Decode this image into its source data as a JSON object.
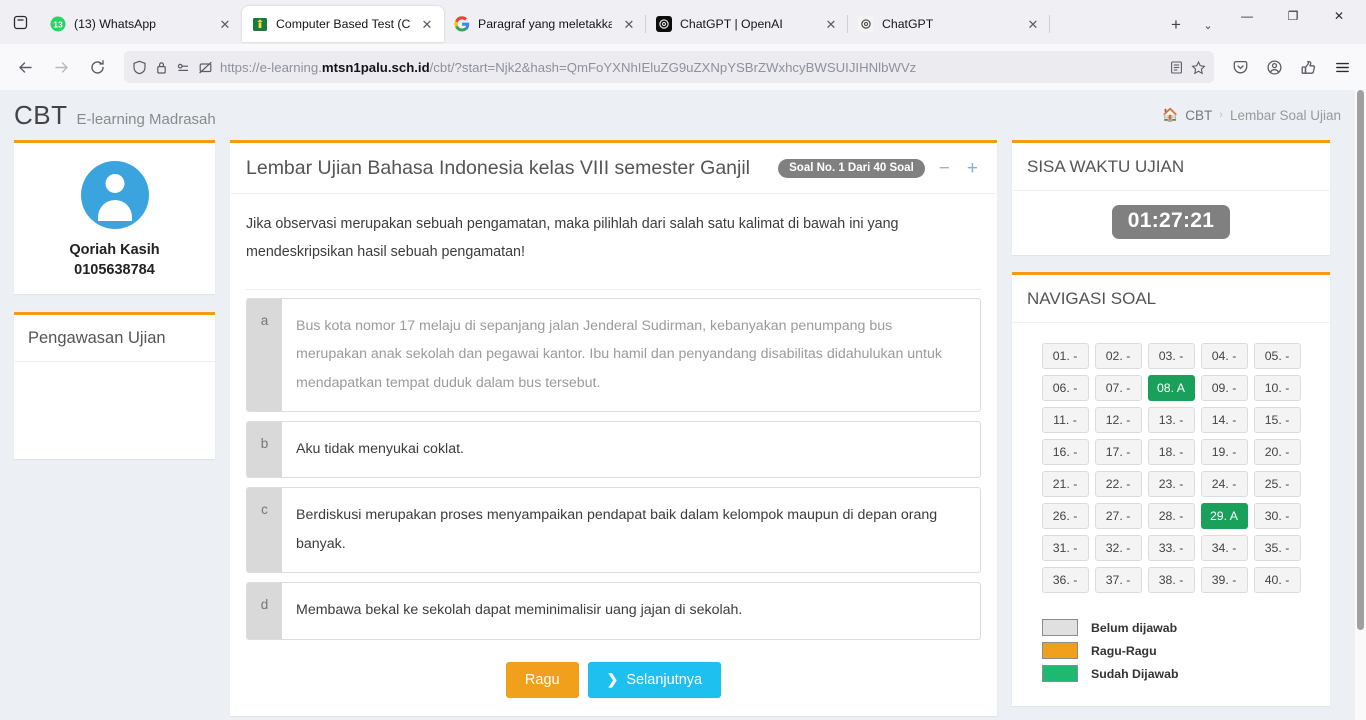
{
  "browser": {
    "tabs": [
      {
        "title": "(13) WhatsApp",
        "favicon": "whatsapp-icon",
        "active": false
      },
      {
        "title": "Computer Based Test (CBT)",
        "favicon": "madrasah-icon",
        "active": true
      },
      {
        "title": "Paragraf yang meletakkan ga",
        "favicon": "google-icon",
        "active": false
      },
      {
        "title": "ChatGPT | OpenAI",
        "favicon": "openai-dark-icon",
        "active": false
      },
      {
        "title": "ChatGPT",
        "favicon": "openai-light-icon",
        "active": false
      }
    ],
    "close_label": "✕",
    "newtab_label": "+",
    "tablist_chevron": "⌄",
    "window": {
      "minimize": "—",
      "maximize": "❐",
      "close": "✕"
    },
    "url": {
      "prefix": "https://e-learning.",
      "domain": "mtsn1palu.sch.id",
      "suffix": "/cbt/?start=Njk2&hash=QmFoYXNhIEluZG9uZXNpYSBrZWxhcyBWSUIJIHNlbWVz"
    }
  },
  "header": {
    "brand": "CBT",
    "brand_sub": "E-learning Madrasah",
    "breadcrumb": {
      "home_icon": "🏠",
      "root": "CBT",
      "separator": "›",
      "current": "Lembar Soal Ujian"
    }
  },
  "sidebar_left": {
    "user": {
      "name": "Qoriah Kasih",
      "id": "0105638784"
    },
    "watch_panel_title": "Pengawasan Ujian"
  },
  "exam": {
    "title": "Lembar Ujian Bahasa Indonesia kelas VIII semester Ganjil",
    "badge": "Soal No. 1 Dari 40 Soal",
    "zoom_out": "−",
    "zoom_in": "+",
    "question": "Jika observasi merupakan sebuah pengamatan, maka pilihlah dari salah satu kalimat di bawah ini yang mendeskripsikan hasil sebuah pengamatan!",
    "options": [
      {
        "letter": "a",
        "text": "Bus kota nomor 17 melaju di sepanjang jalan Jenderal Sudirman, kebanyakan penumpang bus merupakan anak sekolah dan pegawai kantor. Ibu hamil dan penyandang disabilitas didahulukan untuk mendapatkan tempat duduk dalam bus tersebut.",
        "muted": true
      },
      {
        "letter": "b",
        "text": "Aku tidak menyukai coklat.",
        "muted": false
      },
      {
        "letter": "c",
        "text": "Berdiskusi merupakan proses menyampaikan pendapat baik dalam kelompok maupun di depan orang banyak.",
        "muted": false
      },
      {
        "letter": "d",
        "text": "Membawa bekal ke sekolah dapat meminimalisir uang jajan di sekolah.",
        "muted": false
      }
    ],
    "buttons": {
      "doubt": "Ragu",
      "next": "Selanjutnya",
      "next_chevron": "❯"
    }
  },
  "sidebar_right": {
    "timer_title": "SISA WAKTU UJIAN",
    "timer_value": "01:27:21",
    "nav_title": "NAVIGASI SOAL",
    "nav_cells": [
      {
        "label": "01. -",
        "state": "unanswered"
      },
      {
        "label": "02. -",
        "state": "unanswered"
      },
      {
        "label": "03. -",
        "state": "unanswered"
      },
      {
        "label": "04. -",
        "state": "unanswered"
      },
      {
        "label": "05. -",
        "state": "unanswered"
      },
      {
        "label": "06. -",
        "state": "unanswered"
      },
      {
        "label": "07. -",
        "state": "unanswered"
      },
      {
        "label": "08. A",
        "state": "answered"
      },
      {
        "label": "09. -",
        "state": "unanswered"
      },
      {
        "label": "10. -",
        "state": "unanswered"
      },
      {
        "label": "11. -",
        "state": "unanswered"
      },
      {
        "label": "12. -",
        "state": "unanswered"
      },
      {
        "label": "13. -",
        "state": "unanswered"
      },
      {
        "label": "14. -",
        "state": "unanswered"
      },
      {
        "label": "15. -",
        "state": "unanswered"
      },
      {
        "label": "16. -",
        "state": "unanswered"
      },
      {
        "label": "17. -",
        "state": "unanswered"
      },
      {
        "label": "18. -",
        "state": "unanswered"
      },
      {
        "label": "19. -",
        "state": "unanswered"
      },
      {
        "label": "20. -",
        "state": "unanswered"
      },
      {
        "label": "21. -",
        "state": "unanswered"
      },
      {
        "label": "22. -",
        "state": "unanswered"
      },
      {
        "label": "23. -",
        "state": "unanswered"
      },
      {
        "label": "24. -",
        "state": "unanswered"
      },
      {
        "label": "25. -",
        "state": "unanswered"
      },
      {
        "label": "26. -",
        "state": "unanswered"
      },
      {
        "label": "27. -",
        "state": "unanswered"
      },
      {
        "label": "28. -",
        "state": "unanswered"
      },
      {
        "label": "29. A",
        "state": "answered"
      },
      {
        "label": "30. -",
        "state": "unanswered"
      },
      {
        "label": "31. -",
        "state": "unanswered"
      },
      {
        "label": "32. -",
        "state": "unanswered"
      },
      {
        "label": "33. -",
        "state": "unanswered"
      },
      {
        "label": "34. -",
        "state": "unanswered"
      },
      {
        "label": "35. -",
        "state": "unanswered"
      },
      {
        "label": "36. -",
        "state": "unanswered"
      },
      {
        "label": "37. -",
        "state": "unanswered"
      },
      {
        "label": "38. -",
        "state": "unanswered"
      },
      {
        "label": "39. -",
        "state": "unanswered"
      },
      {
        "label": "40. -",
        "state": "unanswered"
      }
    ],
    "legend": [
      {
        "label": "Belum dijawab",
        "color": "#e0e0e0"
      },
      {
        "label": "Ragu-Ragu",
        "color": "#f0a01a"
      },
      {
        "label": "Sudah Dijawab",
        "color": "#1fb871"
      }
    ]
  },
  "colors": {
    "accent_orange": "#f39c12",
    "answered_green": "#19a05a",
    "timer_gray": "#808080",
    "next_blue": "#1ec0ef",
    "page_bg": "#ecf0f5"
  }
}
